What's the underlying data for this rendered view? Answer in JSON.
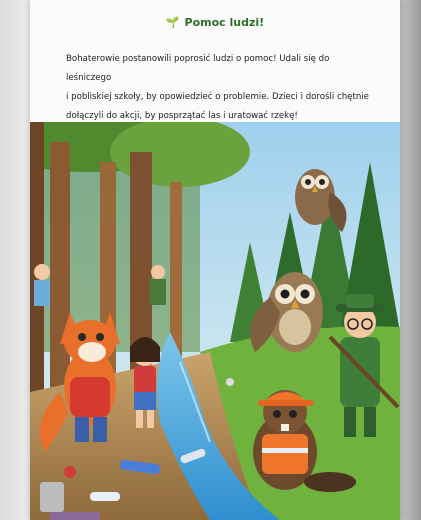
{
  "page": {
    "heading_icon": "sprout-icon",
    "heading": "Pomoc ludzi!",
    "story_lines": [
      "Bohaterowie postanowili poprosić ludzi o pomoc! Udali się do leśniczego",
      "i pobliskiej szkoły, by opowiedzieć o problemie. Dzieci i dorośli chętnie",
      "dołączyli do akcji, by posprzątać las i uratować rzekę!"
    ]
  },
  "illustration": {
    "subject": "forest-cleanup-scene",
    "palette": {
      "sky": "#bfe0f2",
      "grass": "#6fb23d",
      "water": "#4aa8d8",
      "fox": "#e8702a",
      "owl": "#8a6a48",
      "ranger": "#3f7d3a"
    }
  }
}
